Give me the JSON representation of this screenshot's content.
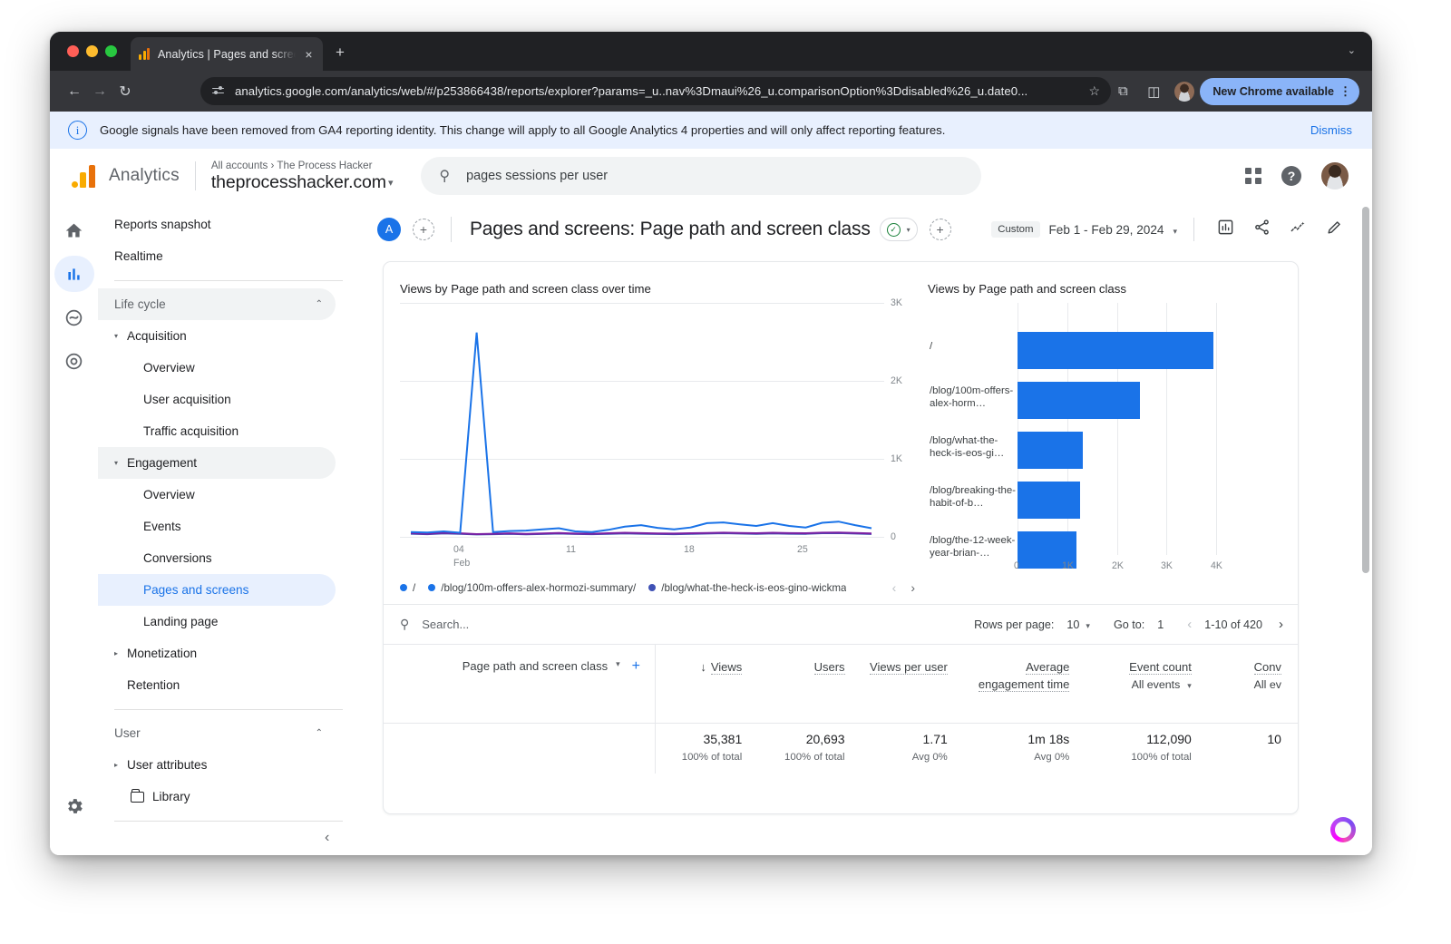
{
  "browser": {
    "tab_title": "Analytics | Pages and screens",
    "favicon": "analytics-bars-icon",
    "new_tab_label": "+",
    "close_label": "×",
    "window_chevron": "⌄",
    "back_label": "←",
    "forward_label": "→",
    "reload_label": "↻",
    "url": "analytics.google.com/analytics/web/#/p253866438/reports/explorer?params=_u..nav%3Dmaui%26_u.comparisonOption%3Ddisabled%26_u.date0...",
    "star_label": "☆",
    "extensions_label": "⧉",
    "sidepanel_label": "◫",
    "chrome_update_label": "New Chrome available",
    "chrome_update_kebab": "⋮"
  },
  "notice": {
    "icon": "info-icon",
    "text": "Google signals have been removed from GA4 reporting identity. This change will apply to all Google Analytics 4 properties and will only affect reporting features.",
    "dismiss_label": "Dismiss"
  },
  "header": {
    "product_name": "Analytics",
    "account_breadcrumb": "All accounts › The Process Hacker",
    "property_name": "theprocesshacker.com",
    "property_caret": "▾",
    "search": {
      "icon": "search-icon",
      "value": "pages sessions per user",
      "placeholder": "Search"
    },
    "apps_icon": "grid-apps-icon",
    "help_icon": "help-icon",
    "avatar": "user-avatar"
  },
  "rail": {
    "items": [
      {
        "name": "home",
        "glyph": "⌂",
        "active": false
      },
      {
        "name": "reports",
        "glyph": "❙❙❙",
        "active": true
      },
      {
        "name": "explore",
        "glyph": "∿",
        "active": false
      },
      {
        "name": "advertising",
        "glyph": "◎",
        "active": false
      }
    ],
    "settings_glyph": "⚙"
  },
  "sidebar": {
    "items": [
      {
        "label": "Reports snapshot",
        "level": "top",
        "state": "normal",
        "arrow": ""
      },
      {
        "label": "Realtime",
        "level": "top",
        "state": "normal",
        "arrow": ""
      },
      {
        "label": "Life cycle",
        "level": "group",
        "state": "highlight",
        "arrow": "",
        "caret": "⌃"
      },
      {
        "label": "Acquisition",
        "level": "sub2",
        "state": "normal",
        "arrow": "▾"
      },
      {
        "label": "Overview",
        "level": "sub",
        "state": "normal",
        "arrow": ""
      },
      {
        "label": "User acquisition",
        "level": "sub",
        "state": "normal",
        "arrow": ""
      },
      {
        "label": "Traffic acquisition",
        "level": "sub",
        "state": "normal",
        "arrow": ""
      },
      {
        "label": "Engagement",
        "level": "sub2",
        "state": "highlight",
        "arrow": "▾"
      },
      {
        "label": "Overview",
        "level": "sub",
        "state": "normal",
        "arrow": ""
      },
      {
        "label": "Events",
        "level": "sub",
        "state": "normal",
        "arrow": ""
      },
      {
        "label": "Conversions",
        "level": "sub",
        "state": "normal",
        "arrow": ""
      },
      {
        "label": "Pages and screens",
        "level": "sub",
        "state": "selected",
        "arrow": ""
      },
      {
        "label": "Landing page",
        "level": "sub",
        "state": "normal",
        "arrow": ""
      },
      {
        "label": "Monetization",
        "level": "sub2",
        "state": "normal",
        "arrow": "▸"
      },
      {
        "label": "Retention",
        "level": "sub2",
        "state": "normal",
        "arrow": ""
      }
    ],
    "user_group": {
      "label": "User",
      "caret": "⌃"
    },
    "user_items": [
      {
        "label": "User attributes",
        "level": "sub2",
        "arrow": "▸"
      },
      {
        "label": "Library",
        "level": "library",
        "arrow": ""
      }
    ],
    "collapse_icon": "‹"
  },
  "report": {
    "avatar_initial": "A",
    "add_user_icon": "+",
    "title": "Pages and screens: Page path and screen class",
    "status_check": "✓",
    "status_caret": "▾",
    "add_comparison_icon": "+",
    "date": {
      "chip": "Custom",
      "range": "Feb 1 - Feb 29, 2024",
      "caret": "▾"
    },
    "tools": [
      {
        "name": "insights-icon",
        "glyph": "▤"
      },
      {
        "name": "share-icon",
        "glyph": "⟨"
      },
      {
        "name": "trend-insights-icon",
        "glyph": "↗"
      },
      {
        "name": "edit-icon",
        "glyph": "✎"
      }
    ]
  },
  "chart_data": [
    {
      "type": "line",
      "title": "Views by Page path and screen class over time",
      "xlabel": "",
      "ylabel": "",
      "ylim": [
        0,
        3000
      ],
      "yticks": [
        "0",
        "1K",
        "2K",
        "3K"
      ],
      "xticks": [
        "04",
        "11",
        "18",
        "25"
      ],
      "xtick_sub": "Feb",
      "grid": true,
      "legend_position": "bottom",
      "x": [
        1,
        2,
        3,
        4,
        5,
        6,
        7,
        8,
        9,
        10,
        11,
        12,
        13,
        14,
        15,
        16,
        17,
        18,
        19,
        20,
        21,
        22,
        23,
        24,
        25,
        26,
        27,
        28,
        29
      ],
      "series": [
        {
          "name": "/",
          "color": "#1a73e8",
          "values": [
            60,
            55,
            70,
            52,
            2620,
            60,
            75,
            80,
            95,
            110,
            70,
            60,
            90,
            130,
            150,
            115,
            95,
            120,
            175,
            185,
            160,
            140,
            175,
            140,
            120,
            180,
            195,
            150,
            110
          ]
        },
        {
          "name": "/blog/100m-offers-alex-hormozi-summary/",
          "color": "#7b1fa2",
          "values": [
            48,
            40,
            52,
            45,
            35,
            40,
            45,
            38,
            44,
            50,
            42,
            40,
            46,
            52,
            48,
            44,
            42,
            46,
            50,
            54,
            50,
            46,
            52,
            48,
            46,
            54,
            56,
            50,
            44
          ]
        },
        {
          "name": "/blog/what-the-heck-is-eos-gino-wickma",
          "color": "#3f51b5",
          "values": [
            40,
            34,
            44,
            38,
            30,
            34,
            38,
            32,
            36,
            42,
            36,
            34,
            38,
            44,
            40,
            36,
            34,
            38,
            42,
            46,
            42,
            38,
            44,
            40,
            38,
            46,
            48,
            42,
            36
          ]
        }
      ],
      "legend_prev": "‹",
      "legend_next": "›"
    },
    {
      "type": "bar",
      "orientation": "horizontal",
      "title": "Views by Page path and screen class",
      "categories": [
        "/",
        "/blog/100m-offers-alex-horm…",
        "/blog/what-the-heck-is-eos-gi…",
        "/blog/breaking-the-habit-of-b…",
        "/blog/the-12-week-year-brian-…"
      ],
      "values": [
        3950,
        2470,
        1320,
        1260,
        1190
      ],
      "color": "#1a73e8",
      "xlim": [
        0,
        4000
      ],
      "xticks": [
        "0",
        "1K",
        "2K",
        "3K",
        "4K"
      ],
      "grid": true
    }
  ],
  "table": {
    "search_icon": "search-icon",
    "search_placeholder": "Search...",
    "rows_per_page_label": "Rows per page:",
    "rows_per_page_value": "10",
    "rows_per_page_caret": "▾",
    "goto_label": "Go to:",
    "goto_value": "1",
    "range_label": "1-10 of 420",
    "prev_icon": "‹",
    "next_icon": "›",
    "dimension": {
      "label": "Page path and screen class",
      "caret": "▾",
      "add_icon": "+"
    },
    "columns": [
      {
        "header": "Views",
        "sort_icon": "↓",
        "sub": "",
        "sub_caret": "",
        "total": "35,381",
        "note": "100% of total"
      },
      {
        "header": "Users",
        "sort_icon": "",
        "sub": "",
        "sub_caret": "",
        "total": "20,693",
        "note": "100% of total"
      },
      {
        "header": "Views per user",
        "sort_icon": "",
        "sub": "",
        "sub_caret": "",
        "total": "1.71",
        "note": "Avg 0%"
      },
      {
        "header": "Average engagement time",
        "sort_icon": "",
        "sub": "",
        "sub_caret": "",
        "total": "1m 18s",
        "note": "Avg 0%"
      },
      {
        "header": "Event count",
        "sort_icon": "",
        "sub": "All events",
        "sub_caret": "▾",
        "total": "112,090",
        "note": "100% of total"
      },
      {
        "header": "Conv",
        "sort_icon": "",
        "sub": "All ev",
        "sub_caret": "",
        "total": "10",
        "note": ""
      }
    ]
  },
  "assistant": {
    "name": "assistant-orb"
  }
}
